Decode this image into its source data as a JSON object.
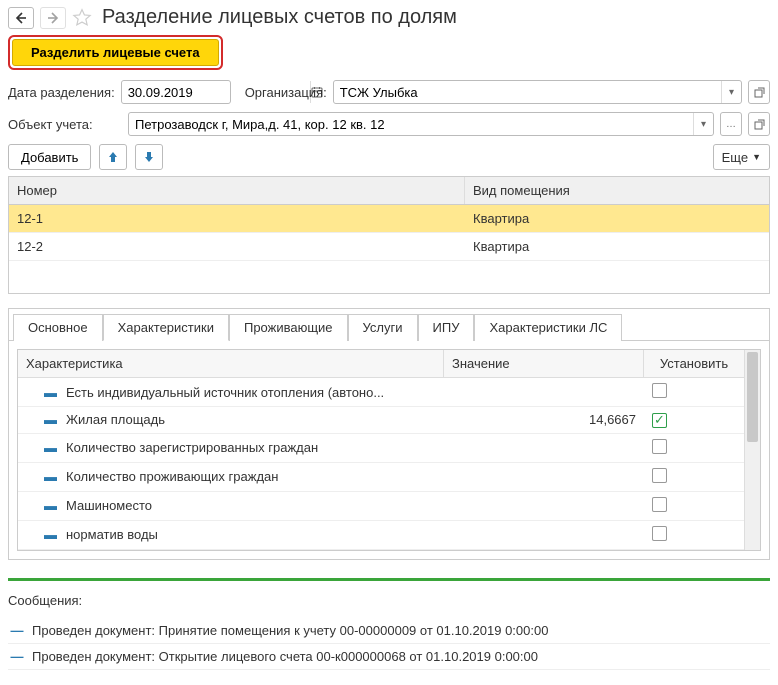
{
  "header": {
    "title": "Разделение лицевых счетов по долям"
  },
  "actions": {
    "split_label": "Разделить лицевые счета"
  },
  "form": {
    "date_label": "Дата разделения:",
    "date_value": "30.09.2019",
    "org_label": "Организация:",
    "org_value": "ТСЖ Улыбка",
    "obj_label": "Объект учета:",
    "obj_value": "Петрозаводск г, Мира,д. 41, кор. 12 кв. 12"
  },
  "toolbar": {
    "add_label": "Добавить",
    "more_label": "Еще"
  },
  "grid": {
    "headers": {
      "number": "Номер",
      "room_type": "Вид помещения"
    },
    "rows": [
      {
        "number": "12-1",
        "room_type": "Квартира",
        "selected": true
      },
      {
        "number": "12-2",
        "room_type": "Квартира",
        "selected": false
      }
    ]
  },
  "tabs": {
    "items": [
      {
        "label": "Основное",
        "active": false
      },
      {
        "label": "Характеристики",
        "active": true
      },
      {
        "label": "Проживающие",
        "active": false
      },
      {
        "label": "Услуги",
        "active": false
      },
      {
        "label": "ИПУ",
        "active": false
      },
      {
        "label": "Характеристики ЛС",
        "active": false
      }
    ]
  },
  "chars": {
    "headers": {
      "name": "Характеристика",
      "value": "Значение",
      "set": "Установить"
    },
    "rows": [
      {
        "name": "Есть индивидуальный источник отопления (автоно...",
        "value": "",
        "set": false
      },
      {
        "name": "Жилая площадь",
        "value": "14,6667",
        "set": true
      },
      {
        "name": "Количество зарегистрированных граждан",
        "value": "",
        "set": false
      },
      {
        "name": "Количество проживающих граждан",
        "value": "",
        "set": false
      },
      {
        "name": "Машиноместо",
        "value": "",
        "set": false
      },
      {
        "name": "норматив воды",
        "value": "",
        "set": false
      }
    ]
  },
  "messages": {
    "title": "Сообщения:",
    "items": [
      "Проведен документ: Принятие помещения к учету 00-00000009 от 01.10.2019 0:00:00",
      "Проведен документ: Открытие лицевого счета 00-к000000068 от 01.10.2019 0:00:00"
    ]
  }
}
